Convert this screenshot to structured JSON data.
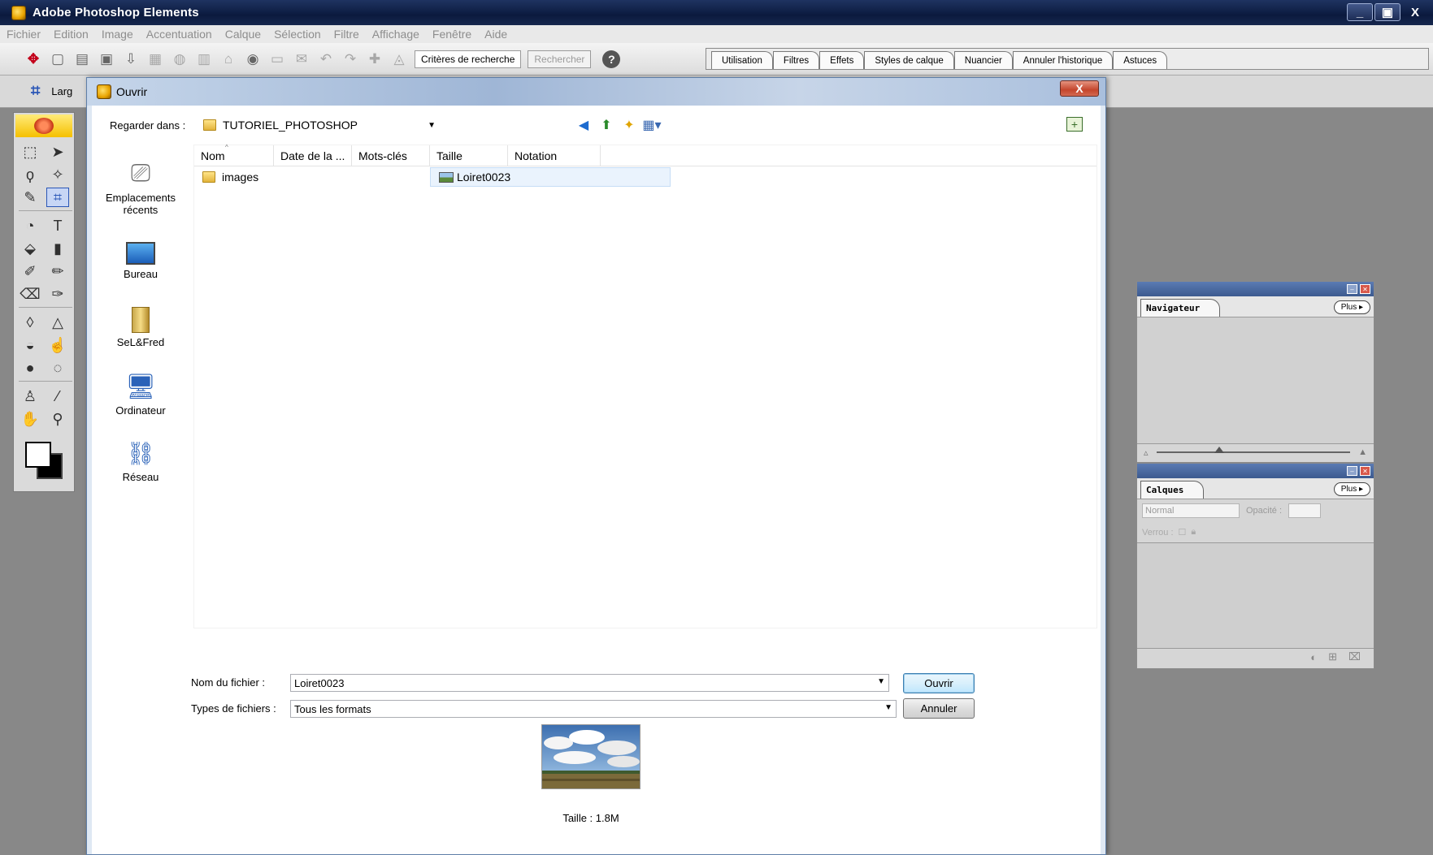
{
  "app": {
    "title": "Adobe Photoshop Elements",
    "window_controls": [
      "_",
      "▣",
      "X"
    ]
  },
  "menu": [
    "Fichier",
    "Edition",
    "Image",
    "Accentuation",
    "Calque",
    "Sélection",
    "Filtre",
    "Affichage",
    "Fenêtre",
    "Aide"
  ],
  "toolbar": {
    "search_criteria_label": "Critères de recherche",
    "search_button_label": "Rechercher",
    "help_label": "?"
  },
  "palette_well": {
    "tabs": [
      "Utilisation",
      "Filtres",
      "Effets",
      "Styles de calque",
      "Nuancier",
      "Annuler l'historique",
      "Astuces"
    ]
  },
  "options_bar": {
    "label": "Larg"
  },
  "dialog": {
    "title": "Ouvrir",
    "close_label": "X",
    "look_in_label": "Regarder dans :",
    "look_in_value": "TUTORIEL_PHOTOSHOP",
    "places": [
      "Emplacements récents",
      "Bureau",
      "SeL&Fred",
      "Ordinateur",
      "Réseau"
    ],
    "columns": [
      "Nom",
      "Date de la ...",
      "Mots-clés",
      "Taille",
      "Notation"
    ],
    "items": [
      {
        "name": "images",
        "type": "folder"
      },
      {
        "name": "Loiret0023",
        "type": "image",
        "selected": true
      }
    ],
    "filename_label": "Nom du fichier :",
    "filename_value": "Loiret0023",
    "filetype_label": "Types de fichiers :",
    "filetype_value": "Tous les formats",
    "open_button": "Ouvrir",
    "cancel_button": "Annuler",
    "preview_caption": "Taille : 1.8M"
  },
  "panels": {
    "navigator": {
      "title": "Navigateur",
      "more_label": "Plus ▸"
    },
    "layers": {
      "title": "Calques",
      "more_label": "Plus ▸",
      "blend_mode": "Normal",
      "opacity_label": "Opacité :",
      "lock_label": "Verrou :"
    }
  },
  "colors": {
    "title_bar": "#0b1a3e",
    "dialog_frame": "#dfe8f3",
    "selection": "#eaf3fd"
  }
}
